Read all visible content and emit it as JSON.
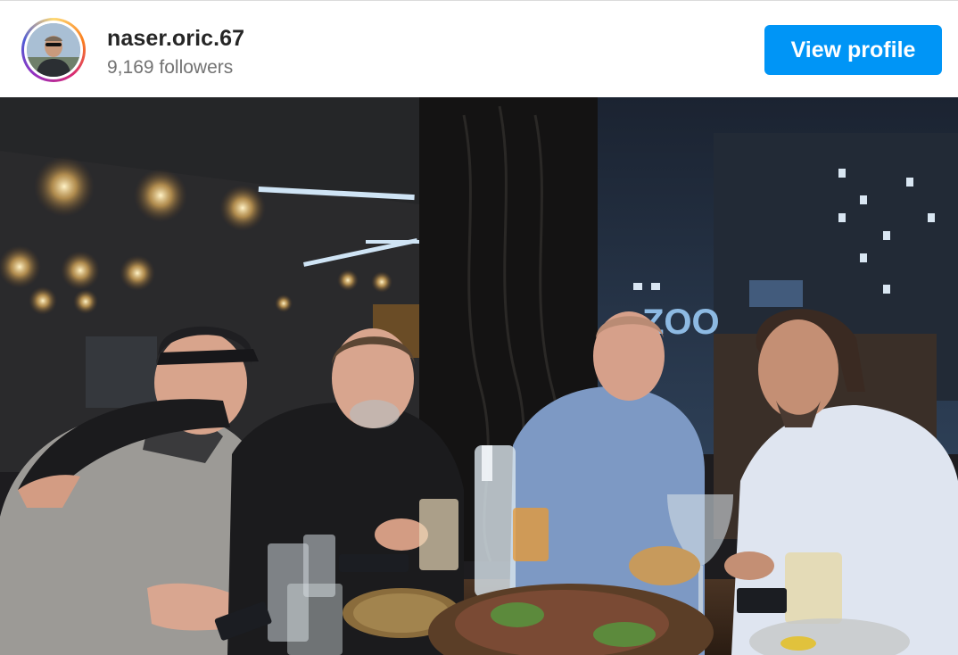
{
  "profile": {
    "username": "naser.oric.67",
    "followers": "9,169 followers",
    "view_profile_label": "View profile",
    "avatar_icon": "profile-photo-icon"
  },
  "post": {
    "image_description_icon": "post-photo",
    "sign_text": "ZOO",
    "colors": {
      "accent": "#0095f6",
      "username": "#262626",
      "secondary_text": "#737373"
    }
  }
}
